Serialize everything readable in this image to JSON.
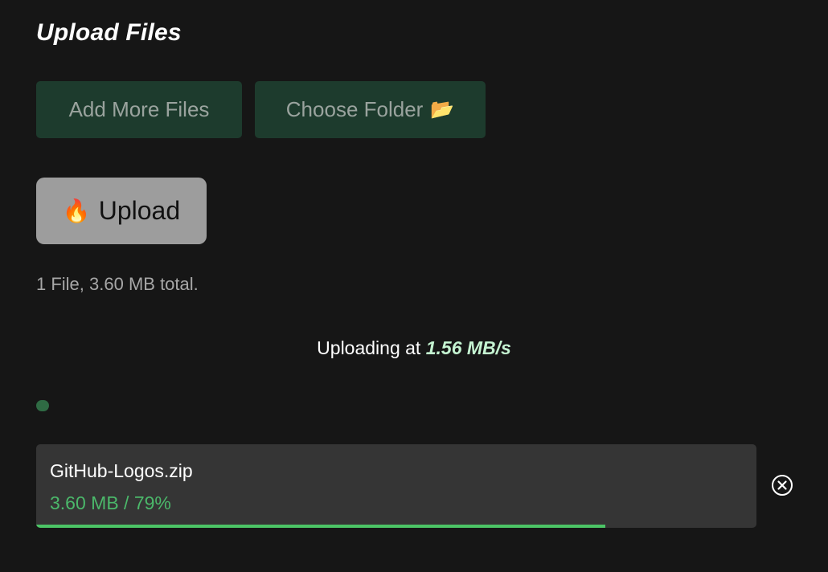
{
  "header": {
    "title": "Upload Files"
  },
  "actions": {
    "add_more_label": "Add More Files",
    "choose_folder_label": "Choose Folder",
    "folder_icon": "📂",
    "upload_label": "Upload",
    "upload_icon": "🔥"
  },
  "summary": {
    "text": "1 File, 3.60 MB total."
  },
  "status": {
    "prefix": "Uploading at ",
    "speed": "1.56 MB/s"
  },
  "overall_progress": {
    "fraction": 0.01
  },
  "files": [
    {
      "name": "GitHub-Logos.zip",
      "status": "3.60 MB / 79%",
      "progress_fraction": 0.79
    }
  ],
  "colors": {
    "background": "#161616",
    "accent_green": "#4cc466",
    "button_green": "#1d3b2d",
    "speed_highlight": "#c4f3d1"
  }
}
